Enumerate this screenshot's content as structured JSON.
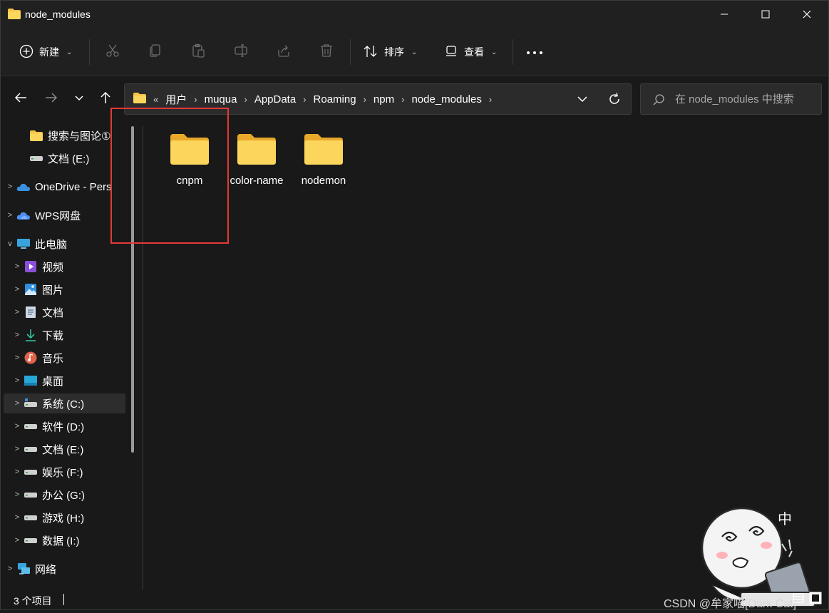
{
  "window": {
    "title": "node_modules",
    "minimize_icon": "minimize-icon",
    "maximize_icon": "maximize-icon",
    "close_icon": "close-icon"
  },
  "toolbar": {
    "new_label": "新建",
    "sort_label": "排序",
    "view_label": "查看",
    "icons": [
      "add-icon",
      "cut-icon",
      "copy-icon",
      "paste-icon",
      "rename-icon",
      "share-icon",
      "delete-icon",
      "sort-icon",
      "view-icon",
      "more-icon"
    ]
  },
  "nav": {
    "breadcrumb": [
      "用户",
      "muqua",
      "AppData",
      "Roaming",
      "npm",
      "node_modules"
    ],
    "overflow": "«",
    "search_placeholder": "在 node_modules 中搜索"
  },
  "sidebar": {
    "items": [
      {
        "label": "搜索与图论①",
        "icon": "folder-icon",
        "expander": ""
      },
      {
        "label": "文档 (E:)",
        "icon": "drive-icon",
        "expander": ""
      },
      {
        "label": "OneDrive - Pers",
        "icon": "onedrive-icon",
        "expander": ">"
      },
      {
        "label": "WPS网盘",
        "icon": "wps-cloud-icon",
        "expander": ">"
      },
      {
        "label": "此电脑",
        "icon": "computer-icon",
        "expander": "v"
      },
      {
        "label": "视频",
        "icon": "video-icon",
        "expander": ">"
      },
      {
        "label": "图片",
        "icon": "pictures-icon",
        "expander": ">"
      },
      {
        "label": "文档",
        "icon": "documents-icon",
        "expander": ">"
      },
      {
        "label": "下载",
        "icon": "download-icon",
        "expander": ">"
      },
      {
        "label": "音乐",
        "icon": "music-icon",
        "expander": ">"
      },
      {
        "label": "桌面",
        "icon": "desktop-icon",
        "expander": ">"
      },
      {
        "label": "系统 (C:)",
        "icon": "system-drive-icon",
        "expander": ">"
      },
      {
        "label": "软件 (D:)",
        "icon": "drive-icon",
        "expander": ">"
      },
      {
        "label": "文档 (E:)",
        "icon": "drive-icon",
        "expander": ">"
      },
      {
        "label": "娱乐 (F:)",
        "icon": "drive-icon",
        "expander": ">"
      },
      {
        "label": "办公 (G:)",
        "icon": "drive-icon",
        "expander": ">"
      },
      {
        "label": "游戏 (H:)",
        "icon": "drive-icon",
        "expander": ">"
      },
      {
        "label": "数据 (I:)",
        "icon": "drive-icon",
        "expander": ">"
      },
      {
        "label": "网络",
        "icon": "network-icon",
        "expander": ">"
      }
    ],
    "selected": "系统 (C:)"
  },
  "files": [
    {
      "name": "cnpm",
      "icon": "folder-icon"
    },
    {
      "name": "color-name",
      "icon": "folder-icon"
    },
    {
      "name": "nodemon",
      "icon": "folder-icon"
    }
  ],
  "status": {
    "item_count": "3 个项目"
  },
  "watermark": "CSDN @牟家喵[Dark Cat]",
  "colors": {
    "accent_folder": "#f6c445",
    "highlight_box": "#e53935",
    "background": "#191919"
  }
}
